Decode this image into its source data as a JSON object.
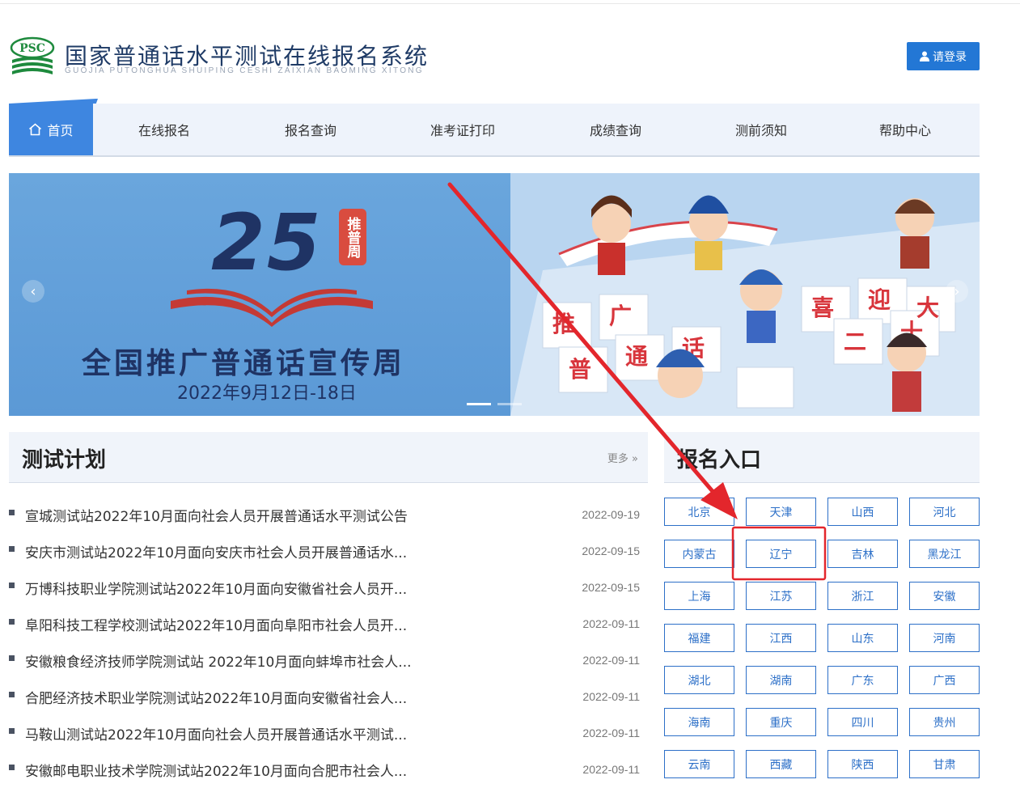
{
  "header": {
    "logo_text": "PSC",
    "title": "国家普通话水平测试在线报名系统",
    "subtitle": "GUOJIA PUTONGHUA SHUIPING CESHI ZAIXIAN BAOMING XITONG",
    "login_label": "请登录"
  },
  "nav": {
    "items": [
      {
        "label": "首页"
      },
      {
        "label": "在线报名"
      },
      {
        "label": "报名查询"
      },
      {
        "label": "准考证打印"
      },
      {
        "label": "成绩查询"
      },
      {
        "label": "测前须知"
      },
      {
        "label": "帮助中心"
      }
    ]
  },
  "banner": {
    "number": "25",
    "tag": "推普周",
    "title": "全国推广普通话宣传周",
    "date": "2022年9月12日-18日",
    "tiles": [
      "推",
      "广",
      "普",
      "通",
      "话",
      "喜",
      "迎",
      "二",
      "十",
      "大"
    ]
  },
  "plans": {
    "title": "测试计划",
    "more_label": "更多",
    "items": [
      {
        "title": "宣城测试站2022年10月面向社会人员开展普通话水平测试公告",
        "date": "2022-09-19"
      },
      {
        "title": "安庆市测试站2022年10月面向安庆市社会人员开展普通话水...",
        "date": "2022-09-15"
      },
      {
        "title": "万博科技职业学院测试站2022年10月面向安徽省社会人员开...",
        "date": "2022-09-15"
      },
      {
        "title": "阜阳科技工程学校测试站2022年10月面向阜阳市社会人员开...",
        "date": "2022-09-11"
      },
      {
        "title": "安徽粮食经济技师学院测试站 2022年10月面向蚌埠市社会人...",
        "date": "2022-09-11"
      },
      {
        "title": "合肥经济技术职业学院测试站2022年10月面向安徽省社会人...",
        "date": "2022-09-11"
      },
      {
        "title": "马鞍山测试站2022年10月面向社会人员开展普通话水平测试...",
        "date": "2022-09-11"
      },
      {
        "title": "安徽邮电职业技术学院测试站2022年10月面向合肥市社会人...",
        "date": "2022-09-11"
      }
    ]
  },
  "entry": {
    "title": "报名入口",
    "provinces": [
      "北京",
      "天津",
      "山西",
      "河北",
      "内蒙古",
      "辽宁",
      "吉林",
      "黑龙江",
      "上海",
      "江苏",
      "浙江",
      "安徽",
      "福建",
      "江西",
      "山东",
      "河南",
      "湖北",
      "湖南",
      "广东",
      "广西",
      "海南",
      "重庆",
      "四川",
      "贵州",
      "云南",
      "西藏",
      "陕西",
      "甘肃"
    ]
  },
  "colors": {
    "accent": "#2377d5",
    "nav_active": "#3e86e0",
    "annotation": "#e3262c"
  }
}
